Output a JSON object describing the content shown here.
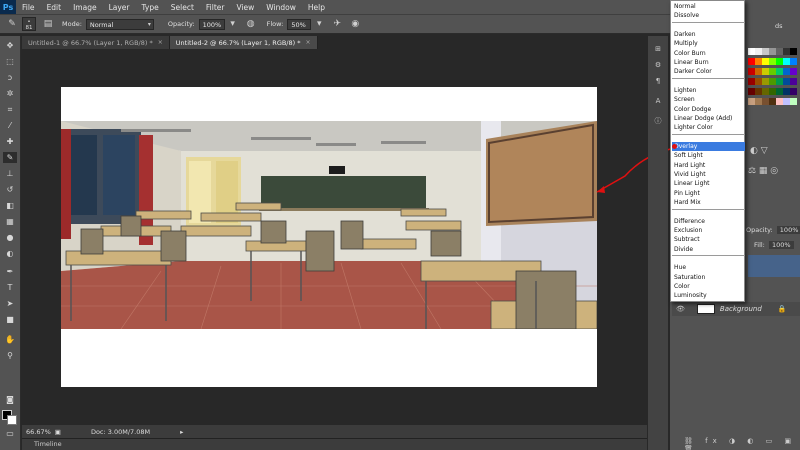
{
  "app": {
    "logo": "Ps"
  },
  "menu": [
    "File",
    "Edit",
    "Image",
    "Layer",
    "Type",
    "Select",
    "Filter",
    "View",
    "Window",
    "Help"
  ],
  "options": {
    "brush_size": "81",
    "mode_label": "Mode:",
    "mode_value": "Normal",
    "opacity_label": "Opacity:",
    "opacity_value": "100%",
    "flow_label": "Flow:",
    "flow_value": "50%"
  },
  "tabs": [
    {
      "label": "Untitled-1 @ 66.7% (Layer 1, RGB/8) *",
      "close": "×",
      "active": false
    },
    {
      "label": "Untitled-2 @ 66.7% (Layer 1, RGB/8) *",
      "close": "×",
      "active": true
    }
  ],
  "status": {
    "zoom": "66.67%",
    "doc": "Doc: 3.00M/7.08M",
    "timeline": "Timeline"
  },
  "blend_modes": {
    "groups": [
      [
        "Normal",
        "Dissolve"
      ],
      [
        "Darken",
        "Multiply",
        "Color Burn",
        "Linear Burn",
        "Darker Color"
      ],
      [
        "Lighten",
        "Screen",
        "Color Dodge",
        "Linear Dodge (Add)",
        "Lighter Color"
      ],
      [
        "Overlay",
        "Soft Light",
        "Hard Light",
        "Vivid Light",
        "Linear Light",
        "Pin Light",
        "Hard Mix"
      ],
      [
        "Difference",
        "Exclusion",
        "Subtract",
        "Divide"
      ],
      [
        "Hue",
        "Saturation",
        "Color",
        "Luminosity"
      ]
    ],
    "selected": "Overlay"
  },
  "layers_panel": {
    "opacity_label": "Opacity:",
    "opacity_value": "100%",
    "fill_label": "Fill:",
    "fill_value": "100%",
    "background_layer": "Background",
    "partial_label": "ds"
  },
  "colors": {
    "accent": "#3a7be0",
    "annotation": "#e01010",
    "foreground": "#000000",
    "background": "#ffffff"
  },
  "icons": {
    "tools": [
      "move-icon",
      "marquee-icon",
      "lasso-icon",
      "quick-select-icon",
      "crop-icon",
      "eyedropper-icon",
      "healing-icon",
      "brush-icon",
      "stamp-icon",
      "history-brush-icon",
      "eraser-icon",
      "gradient-icon",
      "blur-icon",
      "dodge-icon",
      "pen-icon",
      "type-icon",
      "path-select-icon",
      "shape-icon",
      "hand-icon",
      "zoom-icon"
    ]
  }
}
